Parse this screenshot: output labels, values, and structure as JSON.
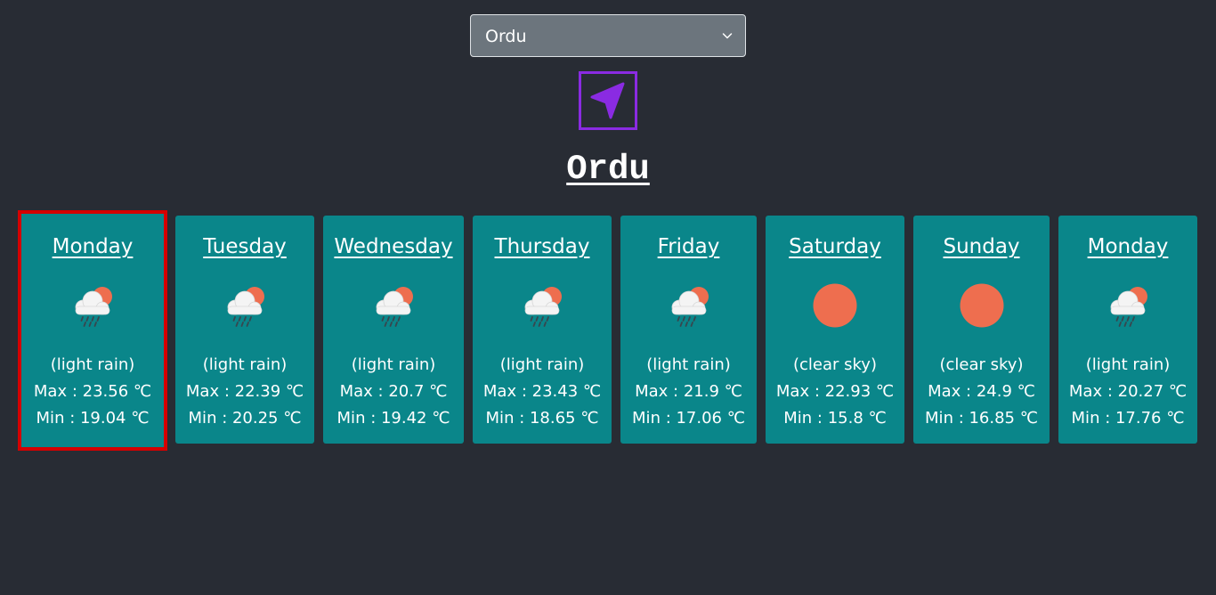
{
  "city_select": {
    "selected": "Ordu",
    "icon": "chevron-down-icon"
  },
  "locate_button": {
    "icon": "navigation-arrow-icon",
    "color": "#8a2be2"
  },
  "city_title": "Ordu",
  "colors": {
    "background": "#282c34",
    "card": "#0a868a",
    "selected_outline": "#d50000",
    "sun": "#ee6e4f"
  },
  "days": [
    {
      "day": "Monday",
      "desc": "(light rain)",
      "max": "Max : 23.56 ℃",
      "min": "Min : 19.04 ℃",
      "icon": "light-rain-icon",
      "selected": true
    },
    {
      "day": "Tuesday",
      "desc": "(light rain)",
      "max": "Max : 22.39 ℃",
      "min": "Min : 20.25 ℃",
      "icon": "light-rain-icon",
      "selected": false
    },
    {
      "day": "Wednesday",
      "desc": "(light rain)",
      "max": "Max : 20.7 ℃",
      "min": "Min : 19.42 ℃",
      "icon": "light-rain-icon",
      "selected": false
    },
    {
      "day": "Thursday",
      "desc": "(light rain)",
      "max": "Max : 23.43 ℃",
      "min": "Min : 18.65 ℃",
      "icon": "light-rain-icon",
      "selected": false
    },
    {
      "day": "Friday",
      "desc": "(light rain)",
      "max": "Max : 21.9 ℃",
      "min": "Min : 17.06 ℃",
      "icon": "light-rain-icon",
      "selected": false
    },
    {
      "day": "Saturday",
      "desc": "(clear sky)",
      "max": "Max : 22.93 ℃",
      "min": "Min : 15.8 ℃",
      "icon": "clear-sky-icon",
      "selected": false
    },
    {
      "day": "Sunday",
      "desc": "(clear sky)",
      "max": "Max : 24.9 ℃",
      "min": "Min : 16.85 ℃",
      "icon": "clear-sky-icon",
      "selected": false
    },
    {
      "day": "Monday",
      "desc": "(light rain)",
      "max": "Max : 20.27 ℃",
      "min": "Min : 17.76 ℃",
      "icon": "light-rain-icon",
      "selected": false
    }
  ]
}
